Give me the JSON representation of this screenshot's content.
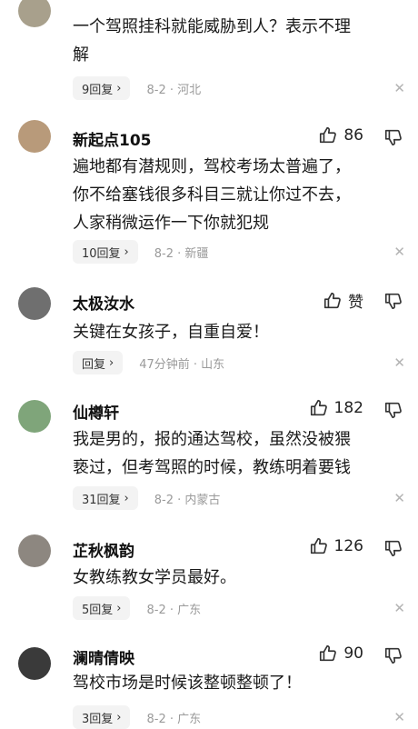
{
  "comments": [
    {
      "username": "",
      "like_count": "",
      "text_lines": [
        "一个驾照挂科就能威胁到人？表示不理",
        "解"
      ],
      "reply_label": "9回复",
      "meta": "8-2 · 河北",
      "avatar_color": "#a8a08c"
    },
    {
      "username": "新起点105",
      "like_count": "86",
      "text_lines": [
        "遍地都有潜规则，驾校考场太普遍了，",
        "你不给塞钱很多科目三就让你过不去，",
        "人家稍微运作一下你就犯规"
      ],
      "reply_label": "10回复",
      "meta": "8-2 · 新疆",
      "avatar_color": "#b89a7a"
    },
    {
      "username": "太极汝水",
      "like_count": "赞",
      "text_lines": [
        "关键在女孩子，自重自爱！"
      ],
      "reply_label": "回复",
      "meta": "47分钟前 · 山东",
      "avatar_color": "#6f6f6f"
    },
    {
      "username": "仙樽轩",
      "like_count": "182",
      "text_lines": [
        "我是男的，报的通达驾校，虽然没被猥",
        "亵过，但考驾照的时候，教练明着要钱"
      ],
      "reply_label": "31回复",
      "meta": "8-2 · 内蒙古",
      "avatar_color": "#7fa57a"
    },
    {
      "username": "芷秋枫韵",
      "like_count": "126",
      "text_lines": [
        "女教练教女学员最好。"
      ],
      "reply_label": "5回复",
      "meta": "8-2 · 广东",
      "avatar_color": "#8d8780"
    },
    {
      "username": "澜晴倩映",
      "like_count": "90",
      "text_lines": [
        "驾校市场是时候该整顿整顿了！"
      ],
      "reply_label": "3回复",
      "meta": "8-2 · 广东",
      "avatar_color": "#3a3a3a"
    }
  ],
  "icons": {
    "like": "thumbs-up-icon",
    "dislike": "thumbs-down-icon",
    "close": "close-icon",
    "chevron": "chevron-right-icon"
  },
  "glyphs": {
    "chevron": "›",
    "close": "✕"
  }
}
